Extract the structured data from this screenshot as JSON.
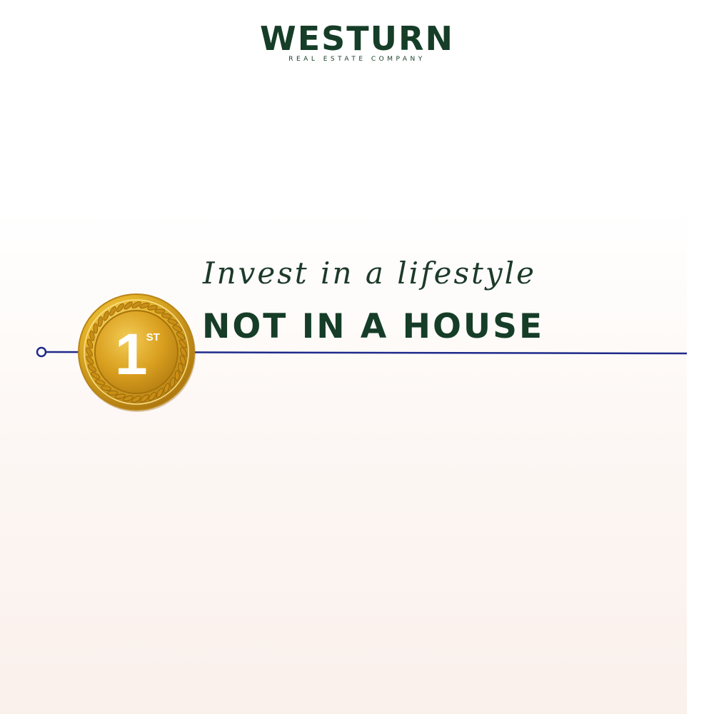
{
  "logo": {
    "name": "WESTURN",
    "subtitle": "REAL ESTATE COMPANY"
  },
  "tagline": {
    "script_line": "Invest in a lifestyle",
    "bold_line": "NOT IN A HOUSE"
  },
  "badge": {
    "number": "1",
    "suffix": "ST"
  },
  "colors": {
    "brand_green": "#163d27",
    "timeline_navy": "#1f2a8a",
    "medal_gold": "#d9a520"
  }
}
